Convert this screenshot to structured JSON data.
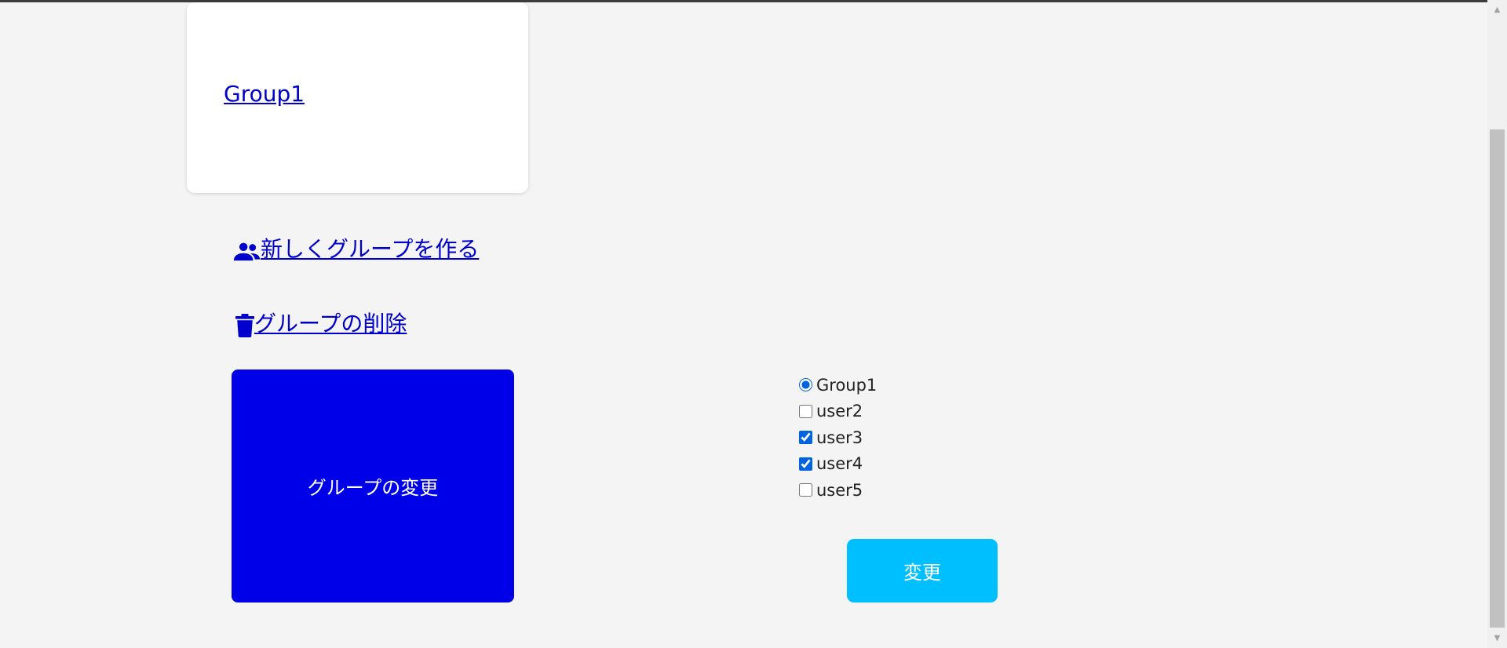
{
  "groups": {
    "list": [
      {
        "label": "Group1"
      }
    ]
  },
  "actions": {
    "new_group_label": "新しくグループを作る",
    "delete_group_label": "グループの削除",
    "change_group_label": "グループの変更"
  },
  "form": {
    "group_radio": {
      "label": "Group1",
      "checked": true
    },
    "users": [
      {
        "label": "user2",
        "checked": false
      },
      {
        "label": "user3",
        "checked": true
      },
      {
        "label": "user4",
        "checked": true
      },
      {
        "label": "user5",
        "checked": false
      }
    ],
    "submit_label": "変更"
  },
  "icons": {
    "new_group": "people-icon",
    "delete_group": "trash-icon"
  },
  "colors": {
    "page_background": "#f4f4f4",
    "link": "#0000cc",
    "change_group_box": "#0000e8",
    "submit_button": "#00bfff"
  }
}
